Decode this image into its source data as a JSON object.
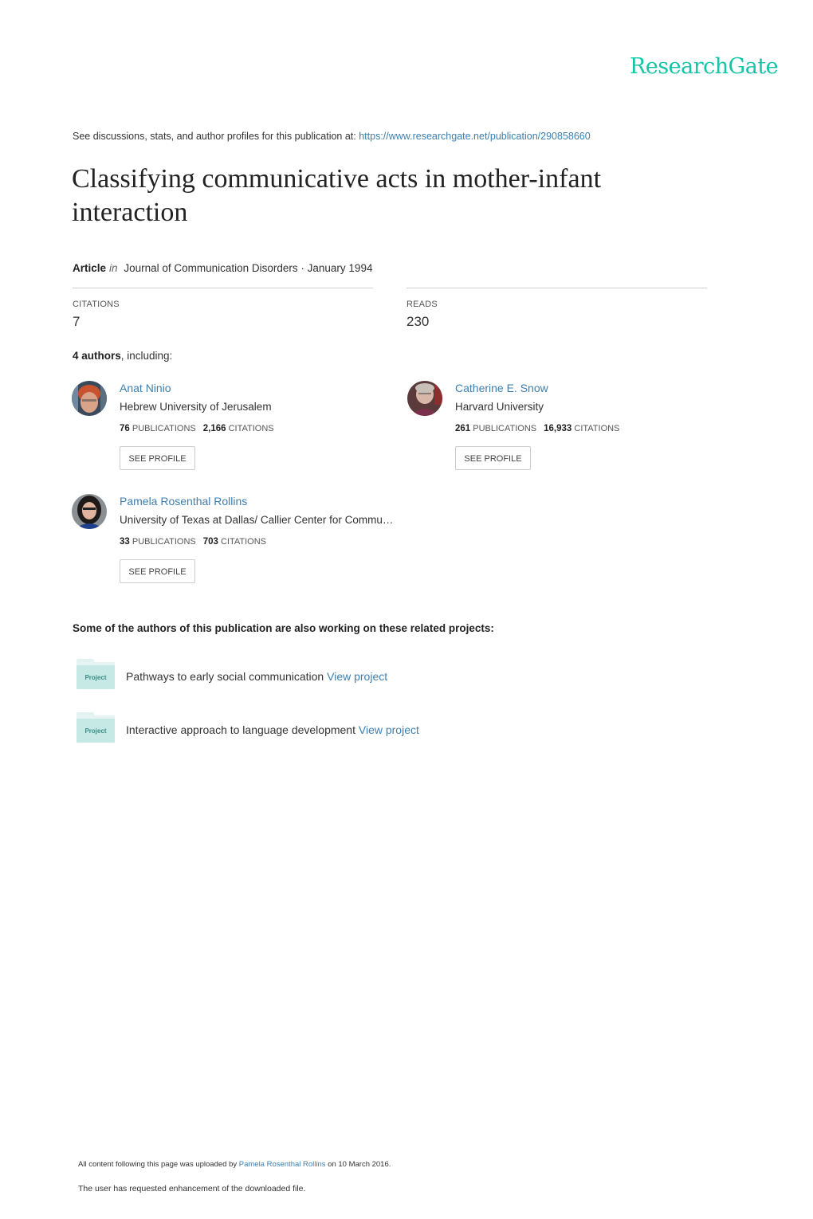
{
  "brand": {
    "logo_text": "ResearchGate",
    "accent_color": "#14c4a7",
    "link_color": "#3d7fb0"
  },
  "header": {
    "intro_text": "See discussions, stats, and author profiles for this publication at: ",
    "publication_url": "https://www.researchgate.net/publication/290858660"
  },
  "publication": {
    "title": "Classifying communicative acts in mother-infant interaction",
    "type": "Article",
    "in_word": "in",
    "journal_date": "Journal of Communication Disorders · January 1994"
  },
  "stats": {
    "citations_label": "CITATIONS",
    "citations_value": "7",
    "reads_label": "READS",
    "reads_value": "230"
  },
  "authors_section": {
    "count_text": "4 authors",
    "suffix": ", including:",
    "authors": [
      {
        "name": "Anat Ninio",
        "institution": "Hebrew University of Jerusalem",
        "publications": "76",
        "publications_label": "PUBLICATIONS",
        "citations": "2,166",
        "citations_label": "CITATIONS",
        "button_label": "SEE PROFILE"
      },
      {
        "name": "Catherine E. Snow",
        "institution": "Harvard University",
        "publications": "261",
        "publications_label": "PUBLICATIONS",
        "citations": "16,933",
        "citations_label": "CITATIONS",
        "button_label": "SEE PROFILE"
      },
      {
        "name": "Pamela Rosenthal Rollins",
        "institution": "University of Texas at Dallas/ Callier Center for Commu…",
        "publications": "33",
        "publications_label": "PUBLICATIONS",
        "citations": "703",
        "citations_label": "CITATIONS",
        "button_label": "SEE PROFILE"
      }
    ]
  },
  "projects_section": {
    "heading": "Some of the authors of this publication are also working on these related projects:",
    "icon_label": "Project",
    "projects": [
      {
        "title": "Pathways to early social communication",
        "link_label": "View project"
      },
      {
        "title": "Interactive approach to language development",
        "link_label": "View project"
      }
    ]
  },
  "footer": {
    "upload_prefix": "All content following this page was uploaded by ",
    "uploader": "Pamela Rosenthal Rollins",
    "upload_suffix": " on 10 March 2016.",
    "enhancement_note": "The user has requested enhancement of the downloaded file."
  }
}
